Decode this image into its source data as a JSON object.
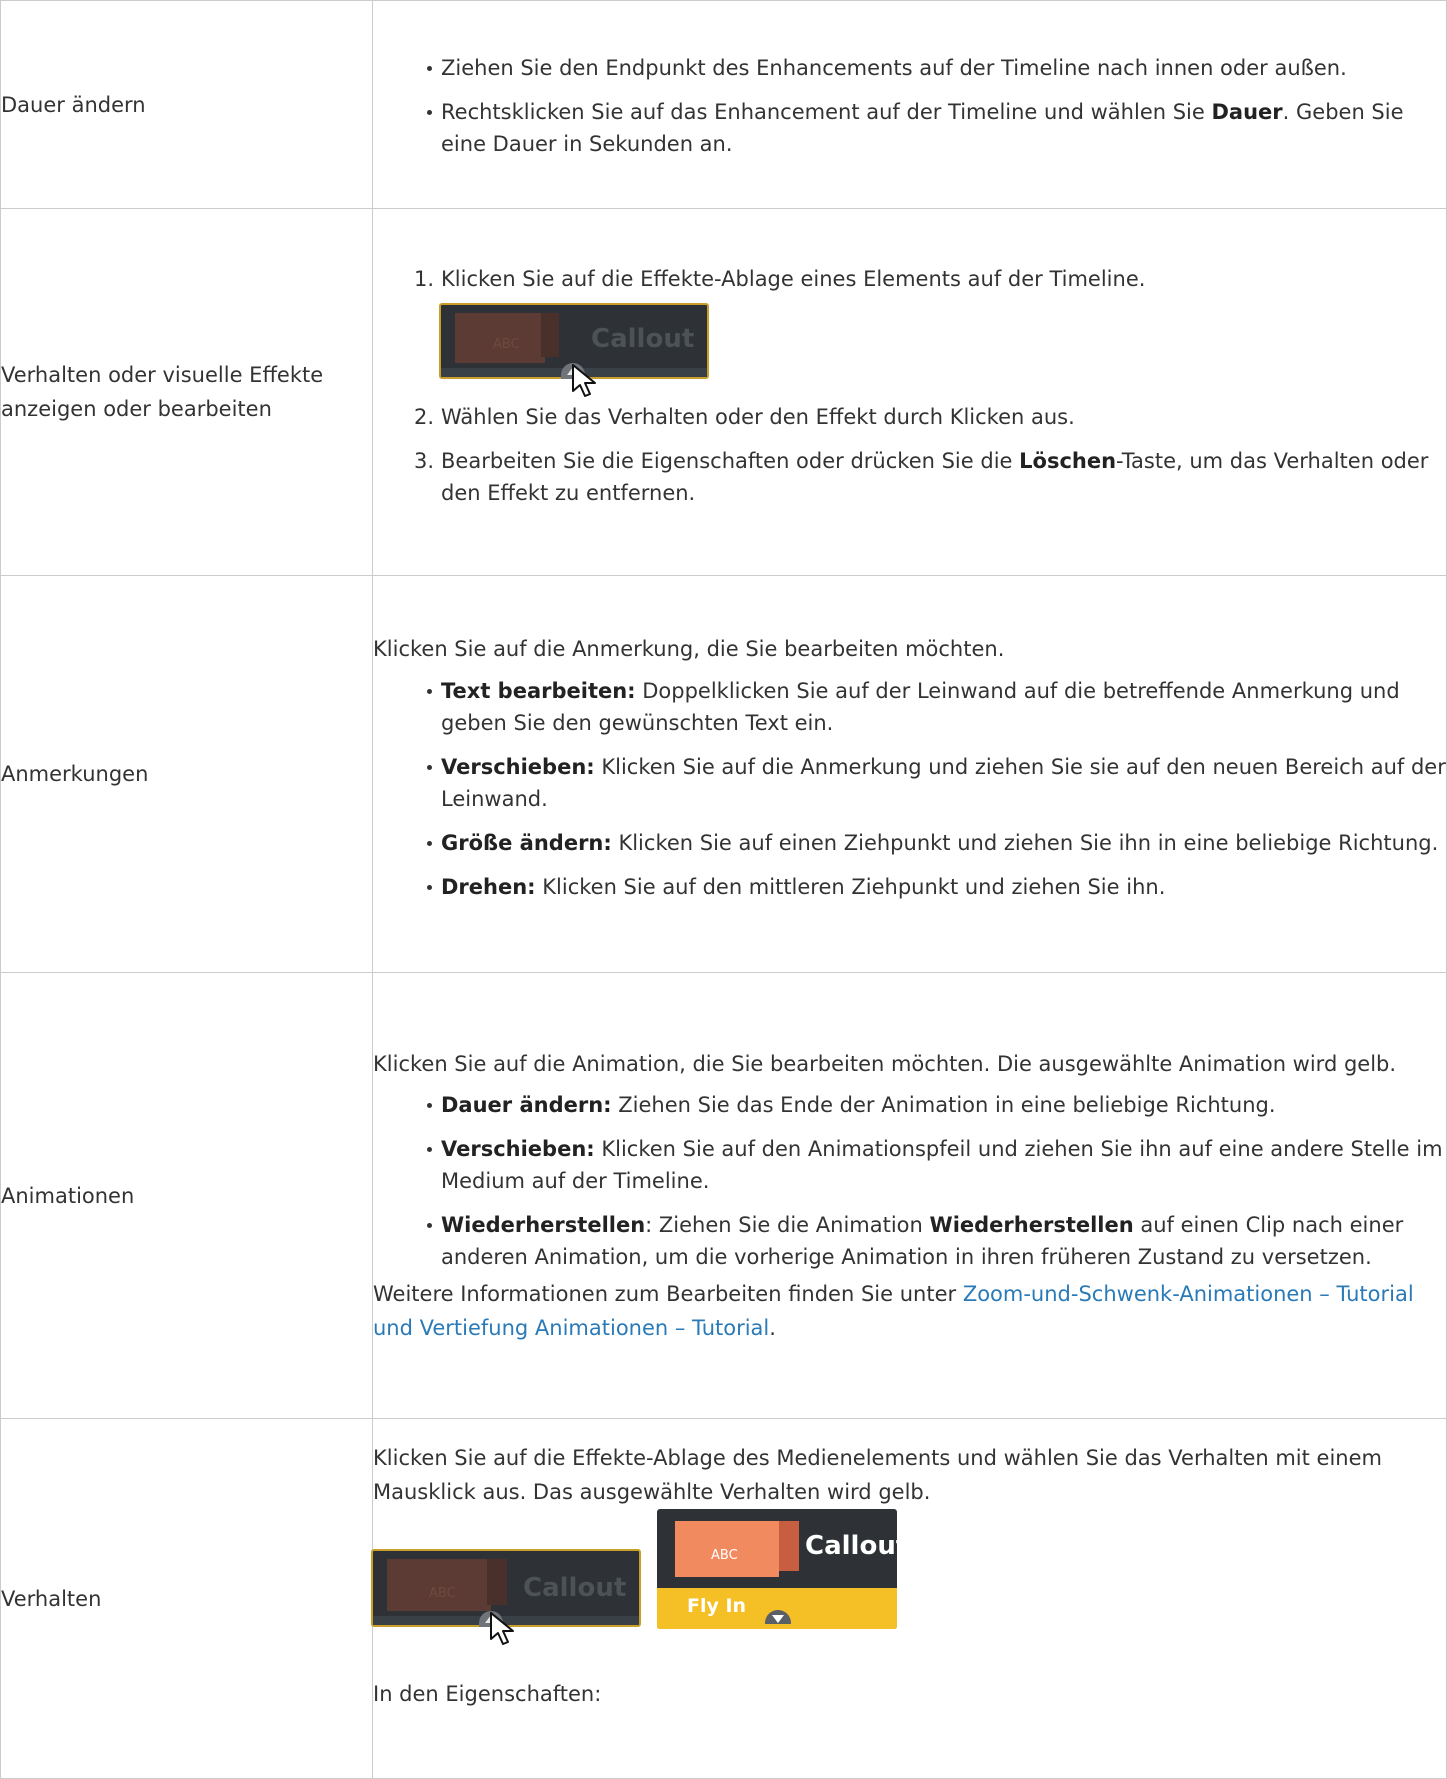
{
  "rows": [
    {
      "label": "Dauer ändern",
      "bullets": [
        {
          "a": "Ziehen Sie den Endpunkt des Enhancements auf der Timeline nach innen oder außen."
        },
        {
          "a": "Rechtsklicken Sie auf das Enhancement auf der Timeline und wählen Sie ",
          "b": "Dauer",
          "c": ". Geben Sie eine Dauer in Sekunden an."
        }
      ]
    },
    {
      "label": "Verhalten oder visuelle Effekte anzeigen oder bearbeiten",
      "steps": [
        {
          "n": "1.",
          "a": "Klicken Sie auf die Effekte-Ablage eines Elements auf der Timeline."
        },
        {
          "n": "2.",
          "a": "Wählen Sie das Verhalten oder den Effekt durch Klicken aus."
        },
        {
          "n": "3.",
          "a": "Bearbeiten Sie die Eigenschaften oder drücken Sie die ",
          "b": "Löschen",
          "c": "-Taste, um das Verhalten oder den Effekt zu entfernen."
        }
      ],
      "thumb": {
        "card_text": "ABC",
        "title": "Callout"
      }
    },
    {
      "label": "Anmerkungen",
      "intro": "Klicken Sie auf die Anmerkung, die Sie bearbeiten möchten.",
      "bullets": [
        {
          "b": "Text bearbeiten:",
          "c": " Doppelklicken Sie auf der Leinwand auf die betreffende Anmerkung und geben Sie den gewünschten Text ein."
        },
        {
          "b": "Verschieben:",
          "c": " Klicken Sie auf die Anmerkung und ziehen Sie sie auf den neuen Bereich auf der Leinwand."
        },
        {
          "b": "Größe ändern:",
          "c": " Klicken Sie auf einen Ziehpunkt und ziehen Sie ihn in eine beliebige Richtung."
        },
        {
          "b": "Drehen:",
          "c": " Klicken Sie auf den mittleren Ziehpunkt und ziehen Sie ihn."
        }
      ]
    },
    {
      "label": "Animationen",
      "intro": "Klicken Sie auf die Animation, die Sie bearbeiten möchten. Die ausgewählte Animation wird gelb.",
      "bullets": [
        {
          "b": "Dauer ändern:",
          "c": " Ziehen Sie das Ende der Animation in eine beliebige Richtung."
        },
        {
          "b": "Verschieben:",
          "c": " Klicken Sie auf den Animationspfeil und ziehen Sie ihn auf eine andere Stelle im Medium auf der Timeline."
        },
        {
          "b": "Wiederherstellen",
          "c": ": Ziehen Sie die Animation ",
          "d": "Wiederherstellen",
          "e": " auf einen Clip nach einer anderen Animation, um die vorherige Animation in ihren früheren Zustand zu versetzen."
        }
      ],
      "outro_pre": "Weitere Informationen zum Bearbeiten finden Sie unter ",
      "outro_link": "Zoom-und-Schwenk-Animationen – Tutorial und Vertiefung Animationen – Tutorial",
      "outro_post": "."
    },
    {
      "label": "Verhalten",
      "intro": "Klicken Sie auf die Effekte-Ablage des Medienelements und wählen Sie das Verhalten mit einem Mausklick aus. Das ausgewählte Verhalten wird gelb.",
      "thumb": {
        "card_text": "ABC",
        "title": "Callout"
      },
      "thumb2": {
        "card_text": "ABC",
        "title": "Callout",
        "band": "Fly In"
      },
      "outro": "In den Eigenschaften:"
    }
  ]
}
